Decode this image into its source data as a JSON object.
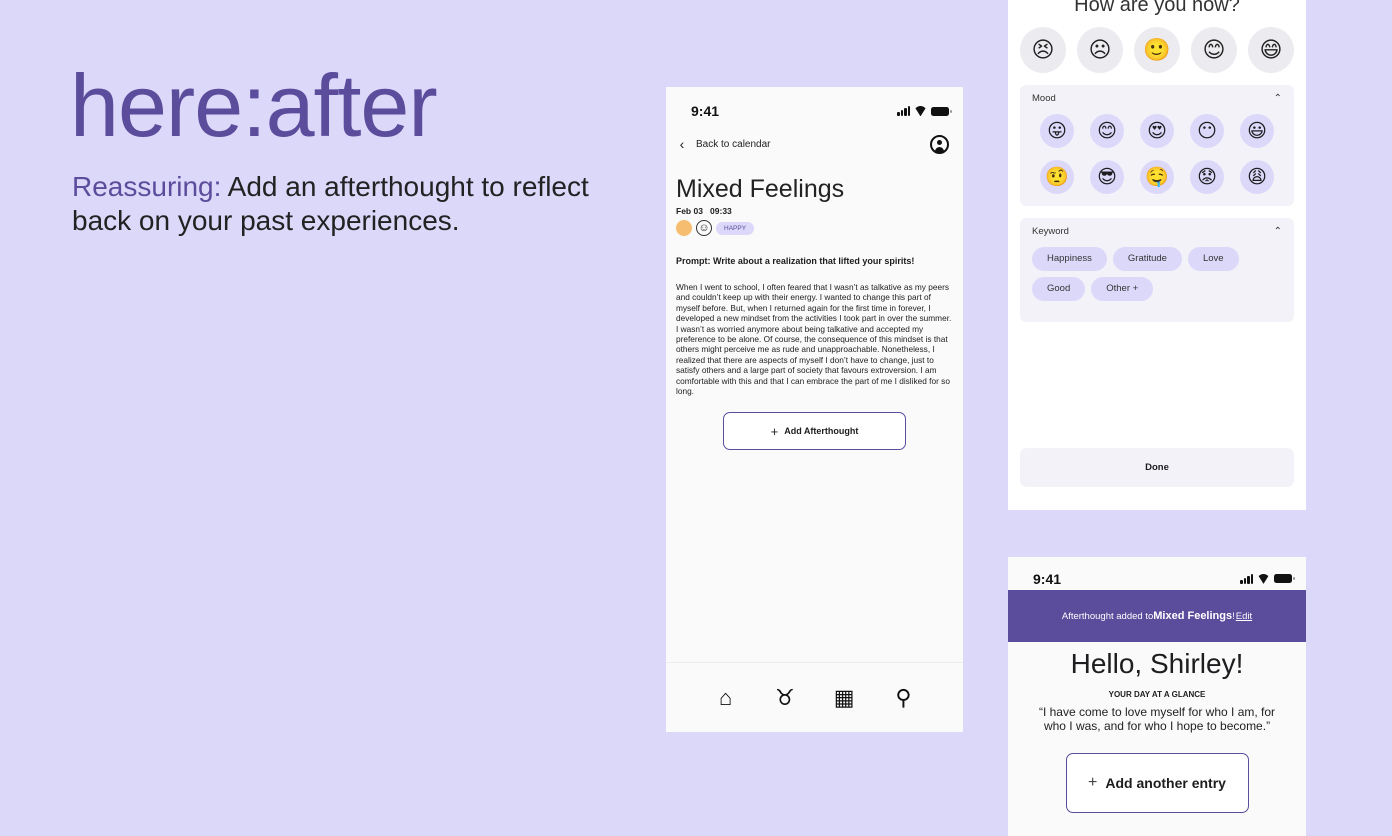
{
  "brand": {
    "name": "here:after"
  },
  "tagline": {
    "accent": "Reassuring:",
    "text": " Add an afterthought to reflect back on your past experiences."
  },
  "phone1": {
    "time": "9:41",
    "back_label": "Back to calendar",
    "title": "Mixed Feelings",
    "date": "Feb 03",
    "clock": "09:33",
    "mood_tag": "HAPPY",
    "prompt": "Prompt: Write about a realization that lifted your spirits!",
    "body": "When I went to school, I often feared that I wasn’t as talkative as my peers and couldn’t keep up with their energy. I wanted to change this part of myself before. But, when I returned again for the first time in forever, I developed a new mindset from the activities I took part in over the summer. I wasn’t as worried anymore about being talkative and accepted my preference to be alone. Of course, the consequence of this mindset is that others might perceive me as rude and unapproachable. Nonetheless, I realized that there are aspects of myself I don’t have to change, just to satisfy others and a large part of society that favours extroversion. I am comfortable with this and that I can embrace the part of me I disliked for so long.",
    "add_afterthought": "Add Afterthought",
    "tabs": [
      "home-icon",
      "lotus-icon",
      "calendar-icon",
      "search-icon"
    ]
  },
  "phone2": {
    "question": "How are you now?",
    "faces": [
      "😣",
      "☹",
      "🙂",
      "😊",
      "😄"
    ],
    "mood_label": "Mood",
    "moods": [
      "😛",
      "😊",
      "😍",
      "😶",
      "😃",
      "🤨",
      "😎",
      "🤤",
      "😟",
      "😩"
    ],
    "keyword_label": "Keyword",
    "keywords": [
      "Happiness",
      "Gratitude",
      "Love",
      "Good",
      "Other +"
    ],
    "done": "Done"
  },
  "phone3": {
    "time": "9:41",
    "banner_prefix": "Afterthought added to ",
    "banner_entry": "Mixed Feelings",
    "banner_suffix": "! ",
    "banner_edit": "Edit",
    "greeting": "Hello, Shirley!",
    "glance": "YOUR DAY AT A GLANCE",
    "quote": "“I have come to love myself for who I am, for who I was, and for who I hope to become.”",
    "add_entry": "Add another entry"
  }
}
